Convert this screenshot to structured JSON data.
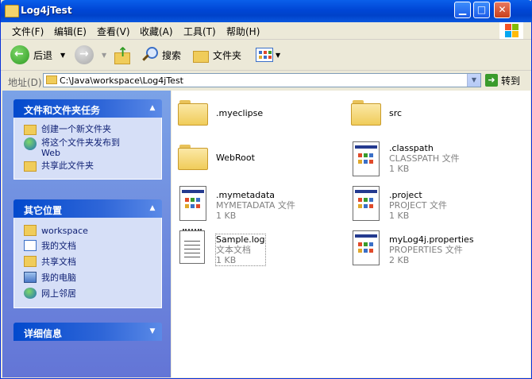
{
  "window": {
    "title": "Log4jTest"
  },
  "menu": [
    "文件(F)",
    "编辑(E)",
    "查看(V)",
    "收藏(A)",
    "工具(T)",
    "帮助(H)"
  ],
  "toolbar": {
    "back_label": "后退",
    "search_label": "搜索",
    "folders_label": "文件夹"
  },
  "address": {
    "label": "地址(D)",
    "path": "C:\\Java\\workspace\\Log4jTest",
    "go_label": "转到"
  },
  "sidebar": {
    "tasks": {
      "title": "文件和文件夹任务",
      "items": [
        "创建一个新文件夹",
        "将这个文件夹发布到",
        "Web",
        "共享此文件夹"
      ]
    },
    "places": {
      "title": "其它位置",
      "items": [
        "workspace",
        "我的文档",
        "共享文档",
        "我的电脑",
        "网上邻居"
      ]
    },
    "details": {
      "title": "详细信息"
    }
  },
  "files": [
    {
      "name": ".myeclipse",
      "type": "folder"
    },
    {
      "name": "src",
      "type": "folder"
    },
    {
      "name": "WebRoot",
      "type": "folder"
    },
    {
      "name": ".classpath",
      "kind": "CLASSPATH 文件",
      "size": "1 KB",
      "type": "doc"
    },
    {
      "name": ".mymetadata",
      "kind": "MYMETADATA 文件",
      "size": "1 KB",
      "type": "doc"
    },
    {
      "name": ".project",
      "kind": "PROJECT 文件",
      "size": "1 KB",
      "type": "doc"
    },
    {
      "name": "Sample.log",
      "kind": "文本文档",
      "size": "1 KB",
      "type": "text"
    },
    {
      "name": "myLog4j.properties",
      "kind": "PROPERTIES 文件",
      "size": "2 KB",
      "type": "doc"
    }
  ],
  "colors": {
    "title_blue": "#0046d5",
    "panel_head": "#0249cd",
    "link": "#0c1d72"
  }
}
